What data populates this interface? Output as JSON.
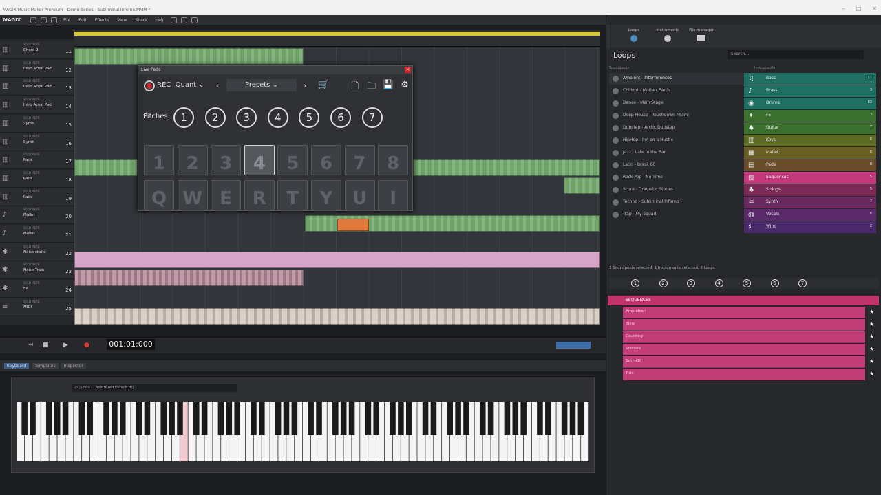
{
  "window": {
    "title": "MAGIX Music Maker Premium - Demo Series - Subliminal Inferno.MMM *"
  },
  "menu": {
    "logo": "MAGIX",
    "items": [
      "File",
      "Edit",
      "Effects",
      "View",
      "Share",
      "Help"
    ]
  },
  "tracks": [
    {
      "name": "Chord 2",
      "num": "11",
      "icon": "piano-icon"
    },
    {
      "name": "Intro Atmo Pad",
      "num": "12",
      "icon": "piano-icon"
    },
    {
      "name": "Intro Atmo Pad",
      "num": "13",
      "icon": "piano-icon"
    },
    {
      "name": "Intro Atmo Pad",
      "num": "14",
      "icon": "piano-icon"
    },
    {
      "name": "Synth",
      "num": "15",
      "icon": "piano-icon"
    },
    {
      "name": "Synth",
      "num": "16",
      "icon": "piano-icon"
    },
    {
      "name": "Pads",
      "num": "17",
      "icon": "piano-icon"
    },
    {
      "name": "Pads",
      "num": "18",
      "icon": "piano-icon"
    },
    {
      "name": "Pads",
      "num": "19",
      "icon": "piano-icon"
    },
    {
      "name": "Mallet",
      "num": "20",
      "icon": "mallet-icon"
    },
    {
      "name": "Mallet",
      "num": "21",
      "icon": "mallet-icon"
    },
    {
      "name": "Noise static",
      "num": "22",
      "icon": "fx-icon"
    },
    {
      "name": "Noise Train",
      "num": "23",
      "icon": "fx-icon"
    },
    {
      "name": "Fx",
      "num": "24",
      "icon": "fx-icon"
    },
    {
      "name": "MIDI",
      "num": "25",
      "icon": "midi-icon"
    }
  ],
  "transport": {
    "time": "001:01:000"
  },
  "keyboard": {
    "tabs": [
      "Keyboard",
      "Templates",
      "Inspector"
    ],
    "preset": "25: Choir - Choir Mixed Default HQ"
  },
  "livepads": {
    "title": "Live Pads",
    "rec": "REC",
    "quant": "Quant",
    "presets": "Presets",
    "pitches_label": "Pitches:",
    "pitches": [
      "1",
      "2",
      "3",
      "4",
      "5",
      "6",
      "7"
    ],
    "pads_top": [
      "1",
      "2",
      "3",
      "4",
      "5",
      "6",
      "7",
      "8"
    ],
    "pads_bottom": [
      "Q",
      "W",
      "E",
      "R",
      "T",
      "Y",
      "U",
      "I"
    ],
    "selected_pad": 3
  },
  "right": {
    "tabs": [
      "Loops",
      "Instruments",
      "File manager"
    ],
    "loops_title": "Loops",
    "search_placeholder": "Search...",
    "soundpools_header": "Soundpools",
    "instruments_header": "Instruments",
    "soundpools": [
      "Ambient - Interferences",
      "Chillout - Mother Earth",
      "Dance - Main Stage",
      "Deep House - Touchdown Miami",
      "Dubstep - Arctic Dubstep",
      "HipHop - I'm on a Hustle",
      "Jazz - Late in the Bar",
      "Latin - Brasil 66",
      "Rock Pop - No Time",
      "Score - Dramatic Stories",
      "Techno - Subliminal Inferno",
      "Trap - My Squad"
    ],
    "instruments": [
      {
        "name": "Bass",
        "count": "11",
        "color": "#1f6f63"
      },
      {
        "name": "Brass",
        "count": "3",
        "color": "#1f6f63"
      },
      {
        "name": "Drums",
        "count": "83",
        "color": "#1f6f63"
      },
      {
        "name": "Fx",
        "count": "3",
        "color": "#3b6f2d"
      },
      {
        "name": "Guitar",
        "count": "7",
        "color": "#3b6f2d"
      },
      {
        "name": "Keys",
        "count": "6",
        "color": "#5c6a23"
      },
      {
        "name": "Mallet",
        "count": "6",
        "color": "#6a6024"
      },
      {
        "name": "Pads",
        "count": "8",
        "color": "#6a4d2a"
      },
      {
        "name": "Sequences",
        "count": "5",
        "color": "#c2387a"
      },
      {
        "name": "Strings",
        "count": "5",
        "color": "#7a2a55"
      },
      {
        "name": "Synth",
        "count": "7",
        "color": "#6b2a5f"
      },
      {
        "name": "Vocals",
        "count": "6",
        "color": "#5a2a6b"
      },
      {
        "name": "Wind",
        "count": "2",
        "color": "#4a2a6b"
      }
    ],
    "status": "1 Soundpools selected, 1 Instruments selected, 6 Loops",
    "pitches": [
      "1",
      "2",
      "3",
      "4",
      "5",
      "6",
      "7"
    ],
    "sequences_header": "SEQUENCES",
    "sequences": [
      "Amphibian",
      "Blow",
      "Counting",
      "Stacked",
      "Swing18",
      "Tide"
    ]
  }
}
